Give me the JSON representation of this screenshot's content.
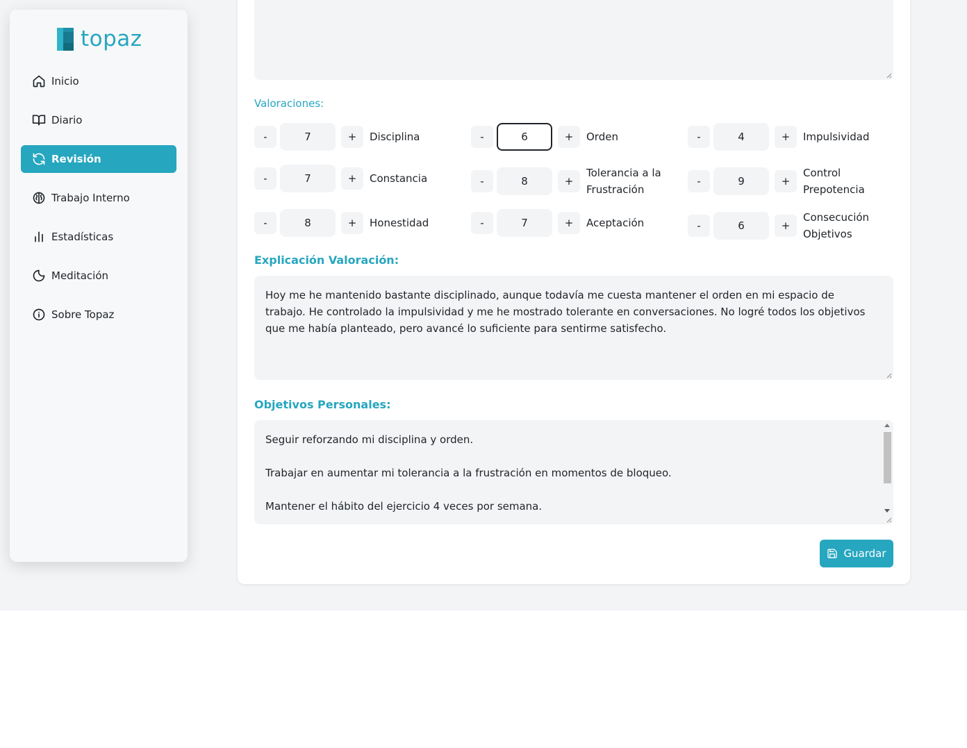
{
  "app": {
    "name": "topaz"
  },
  "sidebar": {
    "items": [
      {
        "label": "Inicio",
        "icon": "home-icon"
      },
      {
        "label": "Diario",
        "icon": "book-icon"
      },
      {
        "label": "Revisión",
        "icon": "refresh-icon",
        "active": true
      },
      {
        "label": "Trabajo Interno",
        "icon": "brain-icon"
      },
      {
        "label": "Estadísticas",
        "icon": "bar-chart-icon"
      },
      {
        "label": "Meditación",
        "icon": "moon-icon"
      },
      {
        "label": "Sobre Topaz",
        "icon": "info-icon"
      }
    ]
  },
  "top_textarea": {
    "visible_text": ""
  },
  "ratings": {
    "label": "Valoraciones:",
    "items": [
      {
        "name": "Disciplina",
        "value": "7"
      },
      {
        "name": "Orden",
        "value": "6"
      },
      {
        "name": "Impulsividad",
        "value": "4"
      },
      {
        "name": "Constancia",
        "value": "7"
      },
      {
        "name": "Tolerancia a la Frustración",
        "value": "8"
      },
      {
        "name": "Control Prepotencia",
        "value": "9"
      },
      {
        "name": "Honestidad",
        "value": "8"
      },
      {
        "name": "Aceptación",
        "value": "7"
      },
      {
        "name": "Consecución Objetivos",
        "value": "6"
      }
    ],
    "minus": "-",
    "plus": "+"
  },
  "explanation": {
    "title": "Explicación Valoración:",
    "text": "Hoy me he mantenido bastante disciplinado, aunque todavía me cuesta mantener el orden en mi espacio de trabajo. He controlado la impulsividad y me he mostrado tolerante en conversaciones. No logré todos los objetivos que me había planteado, pero avancé lo suficiente para sentirme satisfecho."
  },
  "objectives": {
    "title": "Objetivos Personales:",
    "lines": [
      "Seguir reforzando mi disciplina y orden.",
      "Trabajar en aumentar mi tolerancia a la frustración en momentos de bloqueo.",
      "Mantener el hábito del ejercicio 4 veces por semana."
    ]
  },
  "save_button": {
    "label": "Guardar"
  },
  "colors": {
    "accent": "#26a6bf",
    "field": "#f3f4f6",
    "page": "#f3f4f6"
  }
}
